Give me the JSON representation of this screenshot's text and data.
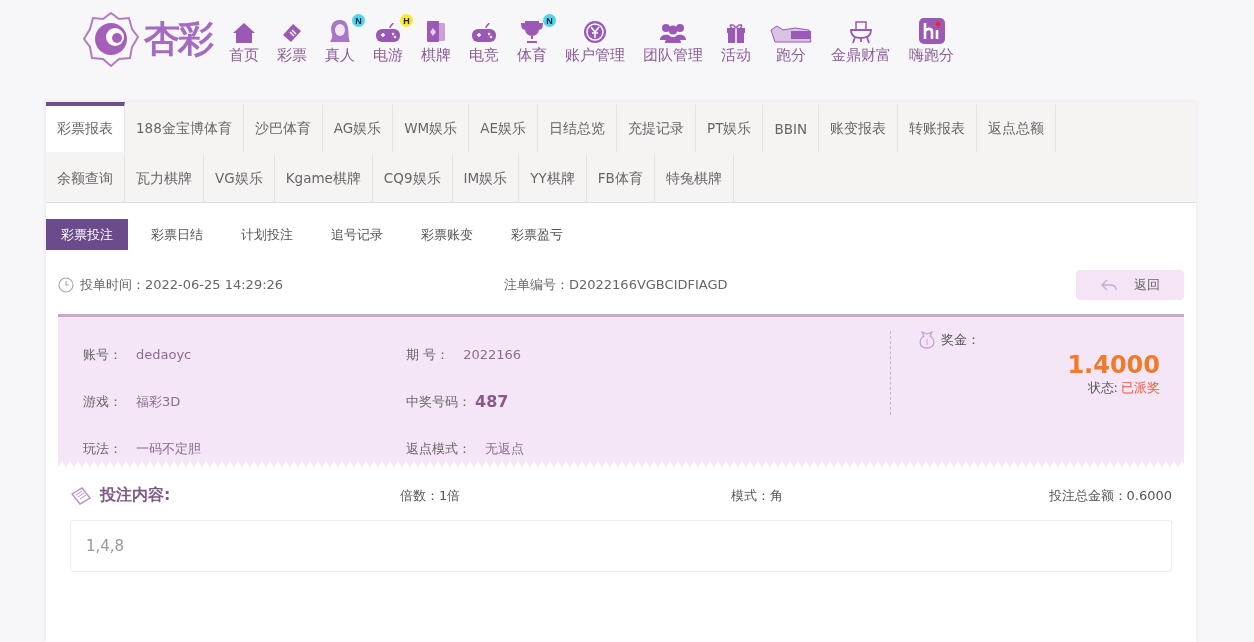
{
  "logo": {
    "text": "杏彩"
  },
  "nav": [
    {
      "label": "首页"
    },
    {
      "label": "彩票"
    },
    {
      "label": "真人",
      "badge": "N",
      "color": "#4fd3f0"
    },
    {
      "label": "电游",
      "badge": "H",
      "color": "#f5e93a"
    },
    {
      "label": "棋牌"
    },
    {
      "label": "电竞"
    },
    {
      "label": "体育",
      "badge": "N",
      "color": "#4fd3f0"
    },
    {
      "label": "账户管理"
    },
    {
      "label": "团队管理"
    },
    {
      "label": "活动"
    },
    {
      "label": "跑分"
    },
    {
      "label": "金鼎财富"
    },
    {
      "label": "嗨跑分"
    }
  ],
  "tab_rows": [
    [
      {
        "label": "彩票报表",
        "selected": true
      },
      {
        "label": "188金宝博体育",
        "selected": false
      },
      {
        "label": "沙巴体育",
        "selected": false
      },
      {
        "label": "AG娱乐",
        "selected": false
      },
      {
        "label": "WM娱乐",
        "selected": false
      },
      {
        "label": "AE娱乐",
        "selected": false
      },
      {
        "label": "日结总览",
        "selected": false
      },
      {
        "label": "充提记录",
        "selected": false
      },
      {
        "label": "PT娱乐",
        "selected": false
      },
      {
        "label": "BBIN",
        "selected": false
      },
      {
        "label": "账变报表",
        "selected": false
      },
      {
        "label": "转账报表",
        "selected": false
      },
      {
        "label": "返点总额",
        "selected": false
      }
    ],
    [
      {
        "label": "余额查询",
        "selected": false
      },
      {
        "label": "瓦力棋牌",
        "selected": false
      },
      {
        "label": "VG娱乐",
        "selected": false
      },
      {
        "label": "Kgame棋牌",
        "selected": false
      },
      {
        "label": "CQ9娱乐",
        "selected": false
      },
      {
        "label": "IM娱乐",
        "selected": false
      },
      {
        "label": "YY棋牌",
        "selected": false
      },
      {
        "label": "FB体育",
        "selected": false
      },
      {
        "label": "特兔棋牌",
        "selected": false
      }
    ]
  ],
  "subtabs": [
    {
      "label": "彩票投注",
      "selected": true
    },
    {
      "label": "彩票日结",
      "selected": false
    },
    {
      "label": "计划投注",
      "selected": false
    },
    {
      "label": "追号记录",
      "selected": false
    },
    {
      "label": "彩票账变",
      "selected": false
    },
    {
      "label": "彩票盈亏",
      "selected": false
    }
  ],
  "order": {
    "time_label": "投单时间：",
    "time": "2022-06-25 14:29:26",
    "id_label": "注单编号：",
    "id": "D2022166VGBCIDFIAGD",
    "back": "返回"
  },
  "details": [
    {
      "label": "账号：",
      "value": "dedaoyc"
    },
    {
      "label": "期 号：",
      "value": "2022166"
    },
    {
      "label": "游戏：",
      "value": "福彩3D"
    },
    {
      "label": "中奖号码：",
      "value": "487",
      "emphasis": true
    },
    {
      "label": "玩法：",
      "value": "一码不定胆"
    },
    {
      "label": "返点模式：",
      "value": "无返点"
    }
  ],
  "prize": {
    "label": "奖金：",
    "amount": "1.4000",
    "status_label": "状态:",
    "status": "已派奖"
  },
  "bet": {
    "title": "投注内容:",
    "multiple": "倍数：1倍",
    "mode": "模式：角",
    "total": "投注总金额：0.6000",
    "content": "1,4,8"
  }
}
